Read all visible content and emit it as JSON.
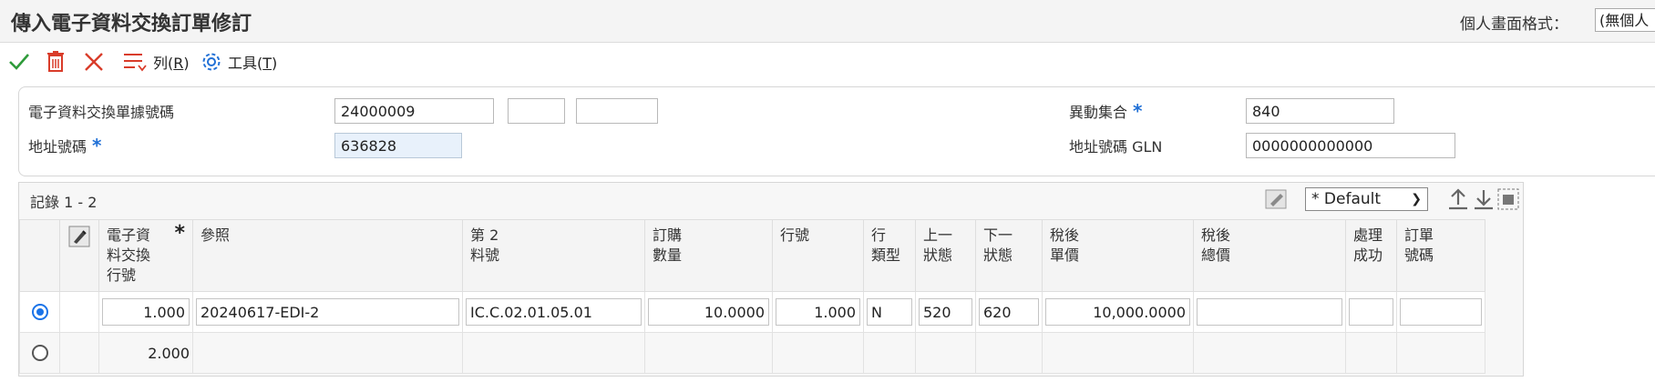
{
  "page": {
    "title": "傳入電子資料交換訂單修訂",
    "personal_view_label": "個人畫面格式：",
    "personal_view_value": "(無個人"
  },
  "toolbar": {
    "rows_label": "列(R)",
    "rows_text": "列(",
    "rows_key": "R",
    "rows_close": ")",
    "tools_text": "工具(",
    "tools_key": "T",
    "tools_close": ")"
  },
  "header": {
    "edi_doc_label": "電子資料交換單據號碼",
    "edi_doc_value": "24000009",
    "edi_doc_type": "",
    "edi_doc_company": "",
    "address_label": "地址號碼",
    "address_value": "636828",
    "batch_label": "異動集合",
    "batch_value": "840",
    "gln_label": "地址號碼 GLN",
    "gln_value": "0000000000000",
    "required_mark": "*"
  },
  "grid": {
    "records_label": "記錄 1 - 2",
    "view_select": "* Default",
    "columns": {
      "edi_line_1": "電子資",
      "edi_line_2": "料交換",
      "edi_line_3": "行號",
      "reference": "參照",
      "second_item_1": "第 2",
      "second_item_2": "料號",
      "qty_1": "訂購",
      "qty_2": "數量",
      "line_no": "行號",
      "line_type_1": "行",
      "line_type_2": "類型",
      "last_status_1": "上一",
      "last_status_2": "狀態",
      "next_status_1": "下一",
      "next_status_2": "狀態",
      "unit_price_1": "稅後",
      "unit_price_2": "單價",
      "total_price_1": "稅後",
      "total_price_2": "總價",
      "processed_1": "處理",
      "processed_2": "成功",
      "order_no_1": "訂單",
      "order_no_2": "號碼"
    },
    "rows": [
      {
        "selected": true,
        "edi_line": "1.000",
        "reference": "20240617-EDI-2",
        "second_item": "IC.C.02.01.05.01",
        "qty": "10.0000",
        "line_no": "1.000",
        "line_type": "N",
        "last_status": "520",
        "next_status": "620",
        "unit_price": "10,000.0000",
        "total_price": "",
        "processed": "",
        "order_no": ""
      },
      {
        "selected": false,
        "edi_line": "2.000"
      }
    ]
  },
  "colors": {
    "accent": "#1f6fd6",
    "ok": "#2e9b3a",
    "delete": "#d93c2a"
  }
}
